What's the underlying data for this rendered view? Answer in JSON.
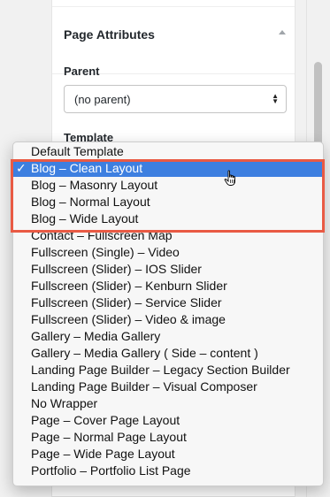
{
  "metabox": {
    "title": "Page Attributes",
    "parent_label": "Parent",
    "parent_value": "(no parent)",
    "template_label": "Template"
  },
  "dropdown": {
    "items": [
      {
        "label": "Default Template",
        "selected": false
      },
      {
        "label": "Blog – Clean Layout",
        "selected": true
      },
      {
        "label": "Blog – Masonry Layout",
        "selected": false
      },
      {
        "label": "Blog – Normal Layout",
        "selected": false
      },
      {
        "label": "Blog – Wide Layout",
        "selected": false
      },
      {
        "label": "Contact – Fullscreen Map",
        "selected": false
      },
      {
        "label": "Fullscreen (Single) – Video",
        "selected": false
      },
      {
        "label": "Fullscreen (Slider) – IOS Slider",
        "selected": false
      },
      {
        "label": "Fullscreen (Slider) – Kenburn Slider",
        "selected": false
      },
      {
        "label": "Fullscreen (Slider) – Service Slider",
        "selected": false
      },
      {
        "label": "Fullscreen (Slider) – Video & image",
        "selected": false
      },
      {
        "label": "Gallery – Media Gallery",
        "selected": false
      },
      {
        "label": "Gallery – Media Gallery ( Side – content )",
        "selected": false
      },
      {
        "label": "Landing Page Builder – Legacy Section Builder",
        "selected": false
      },
      {
        "label": "Landing Page Builder – Visual Composer",
        "selected": false
      },
      {
        "label": "No Wrapper",
        "selected": false
      },
      {
        "label": "Page – Cover Page Layout",
        "selected": false
      },
      {
        "label": "Page – Normal Page Layout",
        "selected": false
      },
      {
        "label": "Page – Wide Page Layout",
        "selected": false
      },
      {
        "label": "Portfolio – Portfolio List Page",
        "selected": false
      }
    ],
    "check_mark": "✓"
  },
  "colors": {
    "selection": "#3d7fe0",
    "highlight_border": "#e95a44"
  }
}
